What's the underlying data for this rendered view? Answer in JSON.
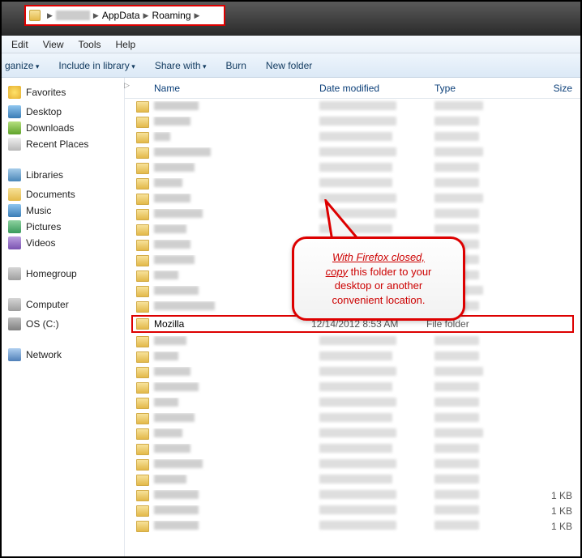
{
  "address": {
    "seg1": "AppData",
    "seg2": "Roaming"
  },
  "menu": {
    "edit": "Edit",
    "view": "View",
    "tools": "Tools",
    "help": "Help"
  },
  "toolbar": {
    "organize": "ganize",
    "include": "Include in library",
    "share": "Share with",
    "burn": "Burn",
    "newfolder": "New folder"
  },
  "columns": {
    "name": "Name",
    "date": "Date modified",
    "type": "Type",
    "size": "Size"
  },
  "nav": {
    "favorites": "Favorites",
    "desktop": "Desktop",
    "downloads": "Downloads",
    "recent": "Recent Places",
    "libraries": "Libraries",
    "documents": "Documents",
    "music": "Music",
    "pictures": "Pictures",
    "videos": "Videos",
    "homegroup": "Homegroup",
    "computer": "Computer",
    "osdrive": "OS (C:)",
    "network": "Network"
  },
  "highlight": {
    "name": "Mozilla",
    "date": "12/14/2012 8:53 AM",
    "type": "File folder"
  },
  "size_kb": "1 KB",
  "callout": {
    "l1a": "With Firefox closed,",
    "l1b": "copy",
    "l2": " this folder to your",
    "l3": "desktop or another",
    "l4": "convenient location."
  }
}
